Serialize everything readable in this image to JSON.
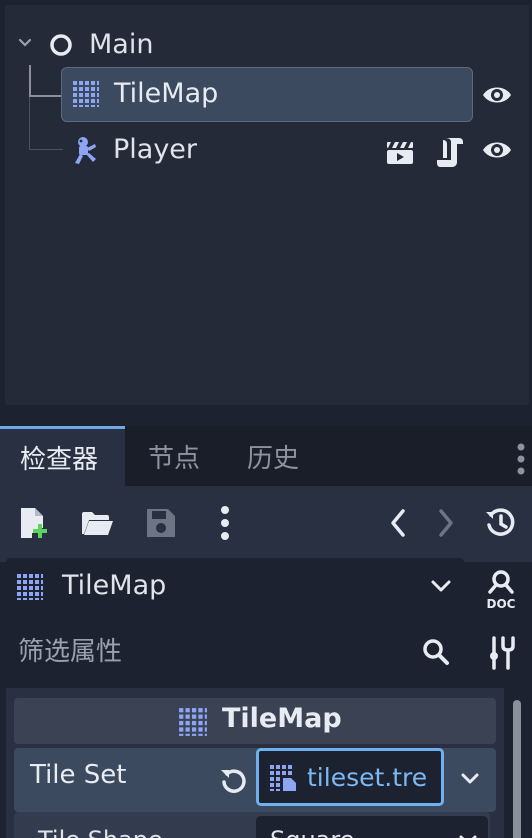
{
  "scene_tree": {
    "root": {
      "label": "Main",
      "icon": "node-circle-icon"
    },
    "children": [
      {
        "label": "TileMap",
        "icon": "tilemap-grid-icon",
        "selected": true
      },
      {
        "label": "Player",
        "icon": "character-body-icon"
      }
    ]
  },
  "dock": {
    "tabs": [
      {
        "label": "检查器",
        "active": true
      },
      {
        "label": "节点",
        "active": false
      },
      {
        "label": "历史",
        "active": false
      }
    ],
    "toolbar": {
      "buttons": [
        "new-resource-icon",
        "open-folder-icon",
        "save-icon",
        "more-vert-icon",
        "back-icon",
        "forward-icon",
        "history-icon"
      ]
    },
    "node_selector": {
      "label": "TileMap"
    },
    "filter": {
      "placeholder": "筛选属性"
    },
    "section": {
      "label": "TileMap"
    },
    "properties": {
      "tile_set": {
        "label": "Tile Set",
        "value": "tileset.tre"
      },
      "tile_shape": {
        "label": "Tile Shape",
        "value": "Square"
      }
    }
  },
  "colors": {
    "accent": "#6fb0ef",
    "selected_bg": "#3b4a5e",
    "panel_bg": "#242a38",
    "icon_blue": "#8da5f3"
  }
}
